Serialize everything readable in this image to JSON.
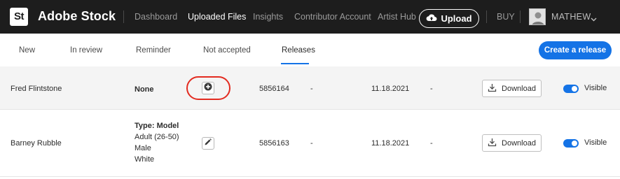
{
  "header": {
    "logo_text": "St",
    "brand": "Adobe Stock",
    "nav": [
      "Dashboard",
      "Uploaded Files",
      "Insights",
      "Contributor Account",
      "Artist Hub"
    ],
    "active_nav": "Uploaded Files",
    "upload_label": "Upload",
    "buy_label": "BUY",
    "user_name": "MATHEW"
  },
  "tabs": {
    "items": [
      "New",
      "In review",
      "Reminder",
      "Not accepted",
      "Releases"
    ],
    "active": "Releases",
    "create_label": "Create a release"
  },
  "releases": [
    {
      "name": "Fred Flintstone",
      "info": [
        "None"
      ],
      "action_icon": "plus-circle-icon",
      "highlighted": true,
      "id": "5856164",
      "dash1": "-",
      "date": "11.18.2021",
      "dash2": "-",
      "download_label": "Download",
      "visible_label": "Visible",
      "visible": true
    },
    {
      "name": "Barney Rubble",
      "info": [
        "Type: Model",
        "Adult (26-50)",
        "Male",
        "White"
      ],
      "action_icon": "pencil-icon",
      "highlighted": false,
      "id": "5856163",
      "dash1": "-",
      "date": "11.18.2021",
      "dash2": "-",
      "download_label": "Download",
      "visible_label": "Visible",
      "visible": true
    }
  ],
  "colors": {
    "topbar": "#1d1d1d",
    "accent": "#1473e6",
    "highlight": "#e32b20",
    "row_alt": "#f4f4f4"
  }
}
